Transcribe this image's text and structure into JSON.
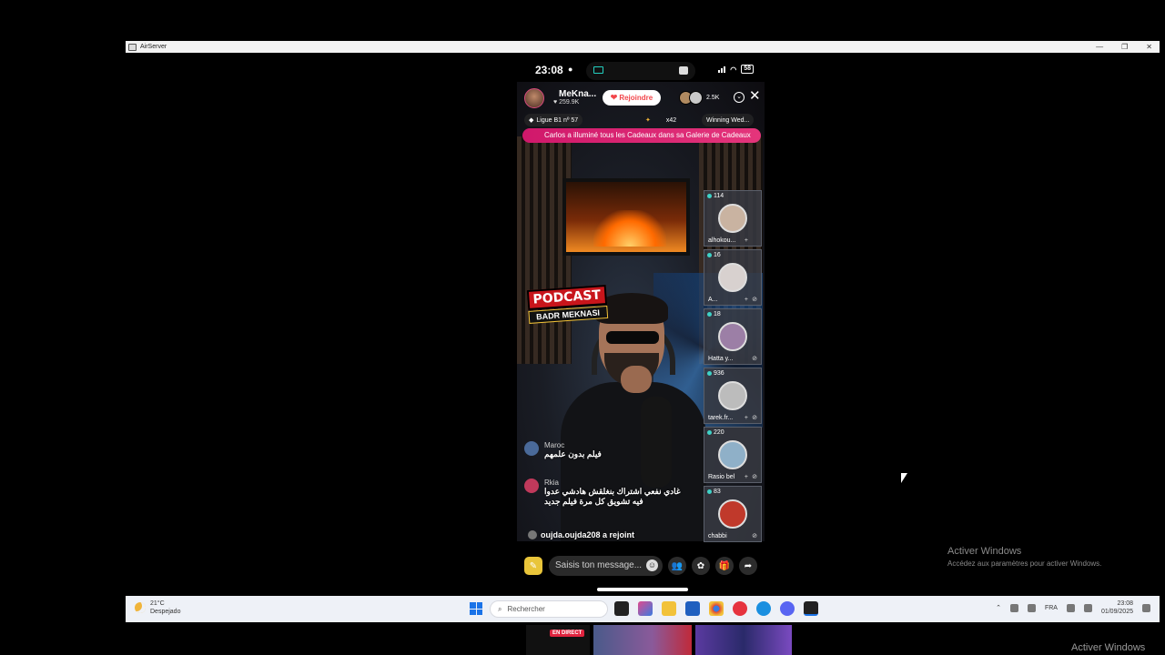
{
  "window": {
    "title": "AirServer",
    "controls": [
      "—",
      "❐",
      "✕"
    ]
  },
  "status_bar": {
    "time": "23:08",
    "battery": "58"
  },
  "live": {
    "host_name": "MeKna...",
    "host_likes": "259.9K",
    "join_label": "Rejoindre",
    "viewer_count": "2.5K",
    "badges": {
      "league": "Ligue B1 nº 57",
      "multiplier": "x42",
      "winning": "Winning Wed..."
    },
    "banner": "Carlos a illuminé tous les Cadeaux dans sa Galerie de Cadeaux",
    "sign_big": "PODCAST",
    "sign_small": "BADR MEKNASI"
  },
  "guests": [
    {
      "count": "114",
      "name": "alhokou...",
      "color": "#c9b3a1"
    },
    {
      "count": "16",
      "name": "A...",
      "color": "#d8d1cf"
    },
    {
      "count": "18",
      "name": "Hatta y...",
      "color": "#9c7fa6"
    },
    {
      "count": "936",
      "name": "tarek.fr...",
      "color": "#bcbcbc"
    },
    {
      "count": "220",
      "name": "Rasio bel",
      "color": "#8fb0c8"
    },
    {
      "count": "83",
      "name": "chabbi",
      "color": "#c0392b"
    }
  ],
  "comments": [
    {
      "user": "Maroc",
      "lines": [
        "فيلم بدون علمهم"
      ]
    },
    {
      "user": "Rkia",
      "lines": [
        "غادي نفعي اشتراك بنغلقش هادشي عدوا",
        "فيه تشويق كل مرة فيلم جديد"
      ]
    }
  ],
  "joined_text": "oujda.oujda208 a rejoint",
  "message_placeholder": "Saisis ton message...",
  "watermark": {
    "title": "Activer Windows",
    "subtitle": "Accédez aux paramètres pour activer Windows."
  },
  "taskbar": {
    "weather_temp": "21°C",
    "weather_desc": "Despejado",
    "search_label": "Rechercher",
    "lang": "FRA",
    "time": "23:08",
    "date": "01/09/2025"
  },
  "thumbnail_live": "EN DIRECT",
  "watermark_bottom": "Activer Windows"
}
